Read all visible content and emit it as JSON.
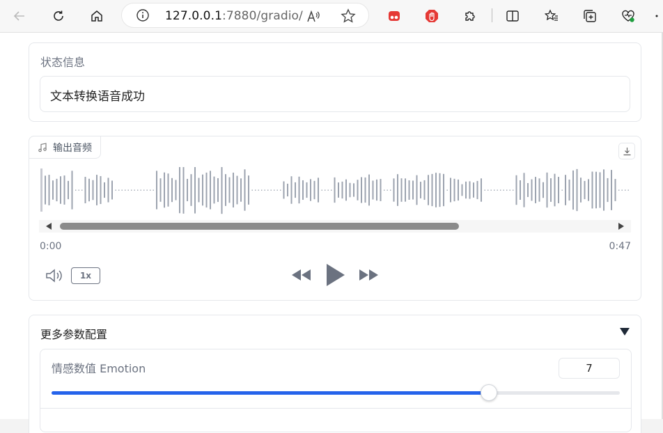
{
  "browser": {
    "url_host": "127.0.0.1",
    "url_rest": ":7880/gradio/"
  },
  "status": {
    "label": "状态信息",
    "value": "文本转换语音成功"
  },
  "audio": {
    "label": "输出音频",
    "time_start": "0:00",
    "time_end": "0:47",
    "playback_rate": "1x"
  },
  "params": {
    "title": "更多参数配置",
    "emotion": {
      "label": "情感数值 Emotion",
      "value": "7",
      "fraction": 0.77
    }
  },
  "colors": {
    "accent": "#2563eb",
    "waveform": "#9ca3af"
  }
}
